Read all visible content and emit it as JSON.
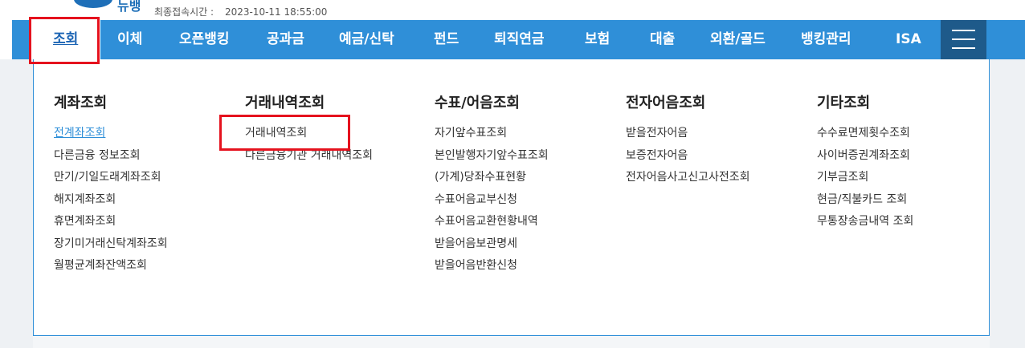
{
  "header": {
    "logo_text": "뉴뱅",
    "last_login_label": "최종접속시간 :",
    "last_login_value": "2023-10-11 18:55:00"
  },
  "nav": {
    "items": [
      "조회",
      "이체",
      "오픈뱅킹",
      "공과금",
      "예금/신탁",
      "펀드",
      "퇴직연금",
      "보험",
      "대출",
      "외환/골드",
      "뱅킹관리",
      "ISA"
    ],
    "active": "조회"
  },
  "menu": {
    "columns": [
      {
        "title": "계좌조회",
        "items": [
          "전계좌조회",
          "다른금융 정보조회",
          "만기/기일도래계좌조회",
          "해지계좌조회",
          "휴면계좌조회",
          "장기미거래신탁계좌조회",
          "월평균계좌잔액조회"
        ]
      },
      {
        "title": "거래내역조회",
        "items": [
          "거래내역조회",
          "다른금융기관 거래내역조회"
        ]
      },
      {
        "title": "수표/어음조회",
        "items": [
          "자기앞수표조회",
          "본인발행자기앞수표조회",
          "(가계)당좌수표현황",
          "수표어음교부신청",
          "수표어음교환현황내역",
          "받을어음보관명세",
          "받을어음반환신청"
        ]
      },
      {
        "title": "전자어음조회",
        "items": [
          "받을전자어음",
          "보증전자어음",
          "전자어음사고신고사전조회"
        ]
      },
      {
        "title": "기타조회",
        "items": [
          "수수료면제횟수조회",
          "사이버증권계좌조회",
          "기부금조회",
          "현금/직불카드 조회",
          "무통장송금내역 조회"
        ]
      }
    ]
  },
  "colors": {
    "nav_bg": "#2f8fd8",
    "menu_button_bg": "#1e5a8a",
    "highlight": "#e5121e",
    "link_active": "#2f8fd8"
  }
}
